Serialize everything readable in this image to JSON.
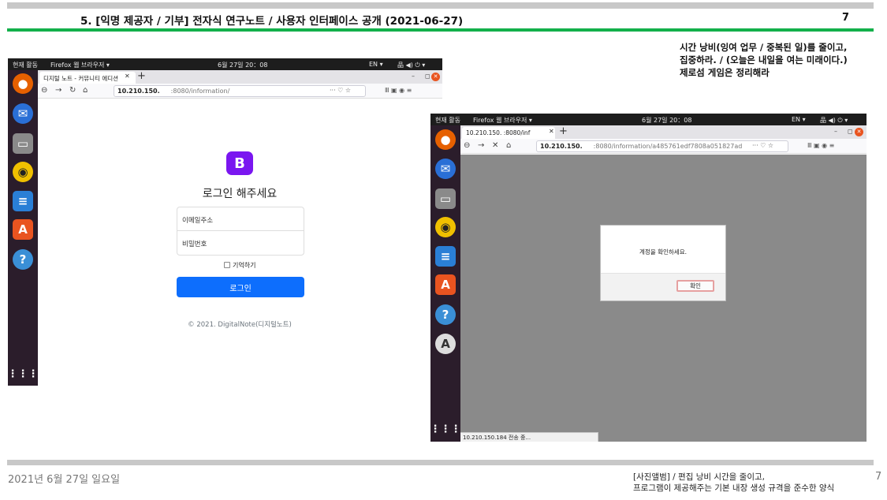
{
  "slide": {
    "title": "5. [익명 제공자 / 기부] 전자식 연구노트 / 사용자 인터페이스 공개 (2021-06-27)",
    "page": "7",
    "notes": [
      "시간 낭비(잉여 업무 / 중복된 일)를 줄이고,",
      "집중하라. / (오늘은 내일을 여는 미래이다.)",
      "제로섬 게임은 정리해라"
    ],
    "footer_date": "2021년 6월 27일 일요일",
    "footer_caption": [
      "[사진앨범] / 편집 낭비 시간을 줄이고,",
      "프로그램이 제공해주는 기본 내장 생성 규격을 준수한 양식"
    ],
    "footer_page": "7"
  },
  "os": {
    "activities": "현재 활동",
    "app_menu": "Firefox 웹 브라우저 ▾",
    "clock": "6월 27일 20：08",
    "lang": "EN ▾",
    "tray": "品 ◀) ⏻ ▾"
  },
  "left_browser": {
    "tab_title": "디지털 노트 - 커뮤니티 에디션",
    "url_host": "10.210.150.",
    "url_path": ":8080/information/",
    "logo_letter": "B",
    "login_title": "로그인 해주세요",
    "email_placeholder": "이메일주소",
    "password_placeholder": "비밀번호",
    "remember_label": "기억하기",
    "login_button": "로그인",
    "copyright": "© 2021. DigitalNote(디지털노트)"
  },
  "right_browser": {
    "tab_title": "10.210.150.        :8080/inf",
    "url_host": "10.210.150.",
    "url_path": ":8080/information/a485761edf7808a051827ad",
    "dialog_message": "계정을 확인하세요.",
    "dialog_button": "확인",
    "status_text": "10.210.150.184 전송 중..."
  },
  "colors": {
    "accent_green": "#13b04b",
    "bootstrap_primary": "#0d6efd",
    "bootstrap_purple": "#7a16f0",
    "ubuntu_orange": "#e95420"
  }
}
